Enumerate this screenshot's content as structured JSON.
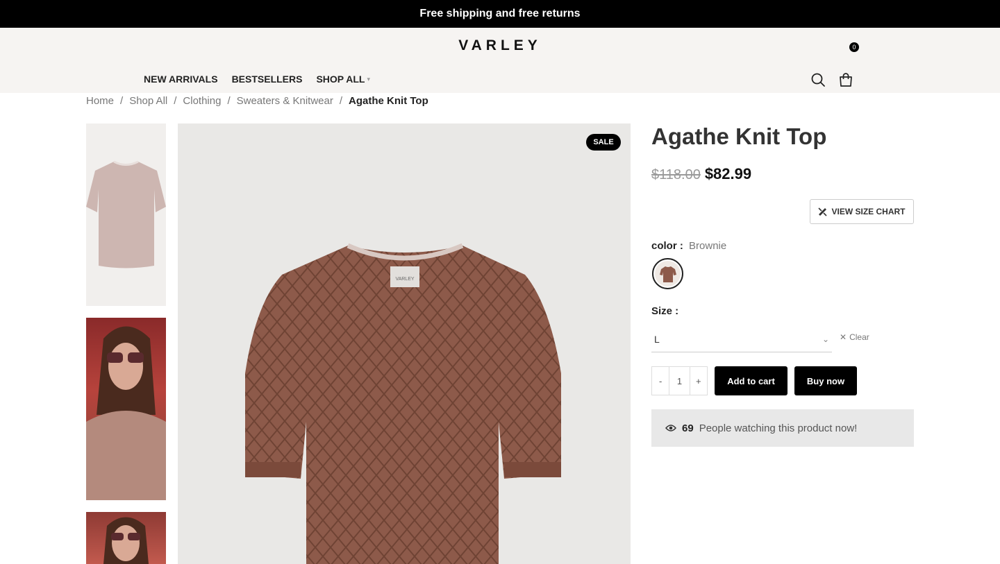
{
  "topbar": {
    "message": "Free shipping and free returns"
  },
  "header": {
    "logo": "VARLEY",
    "nav": [
      {
        "label": "NEW ARRIVALS"
      },
      {
        "label": "BESTSELLERS"
      },
      {
        "label": "SHOP ALL"
      }
    ],
    "cart_count": "0"
  },
  "breadcrumb": {
    "items": [
      "Home",
      "Shop All",
      "Clothing",
      "Sweaters & Knitwear"
    ],
    "separator": "/",
    "current": "Agathe Knit Top"
  },
  "gallery": {
    "sale_badge": "SALE",
    "main_tag": "VARLEY"
  },
  "product": {
    "title": "Agathe Knit Top",
    "old_price": "$118.00",
    "new_price": "$82.99",
    "size_chart_label": "VIEW SIZE CHART",
    "color_label": "color :",
    "color_value": "Brownie",
    "size_label": "Size :",
    "size_value": "L",
    "clear_label": "Clear",
    "qty_minus": "-",
    "qty_value": "1",
    "qty_plus": "+",
    "add_to_cart": "Add to cart",
    "buy_now": "Buy now",
    "watchers_count": "69",
    "watchers_text": "People watching this product now!"
  },
  "colors": {
    "accent": "#000000",
    "sweater": "#8d5a4a"
  }
}
